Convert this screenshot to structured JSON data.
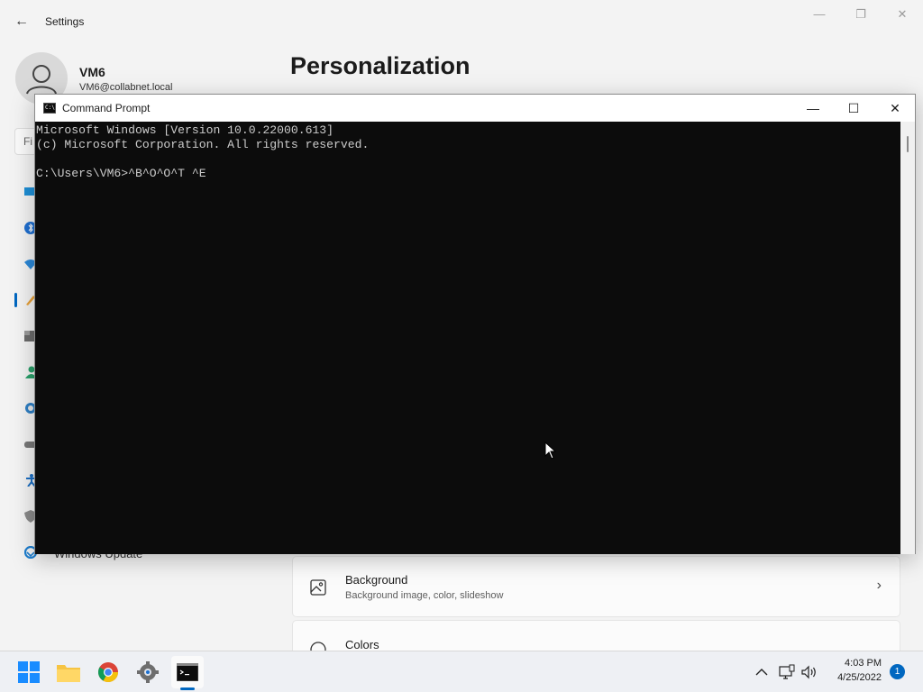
{
  "settings": {
    "app_title": "Settings",
    "back_glyph": "←",
    "controls": {
      "minimize": "—",
      "restore": "❐",
      "close": "✕"
    },
    "user": {
      "name": "VM6",
      "email": "VM6@collabnet.local"
    },
    "page_heading": "Personalization",
    "search_partial": "Fi",
    "nav_icons": [
      "display-icon",
      "bluetooth-icon",
      "network-icon",
      "personalization-brush-icon",
      "apps-icon",
      "accounts-icon",
      "time-language-icon",
      "gaming-icon",
      "accessibility-icon",
      "privacy-shield-icon",
      "windows-update-icon"
    ],
    "nav_visible_label": "Windows Update",
    "cards": [
      {
        "icon": "background-image-icon",
        "title": "Background",
        "subtitle": "Background image, color, slideshow"
      },
      {
        "icon": "colors-palette-icon",
        "title": "Colors",
        "subtitle": ""
      }
    ],
    "accent_color": "#0067c0"
  },
  "cmd": {
    "title": "Command Prompt",
    "icon_text": "C:\\",
    "controls": {
      "minimize": "—",
      "maximize": "☐",
      "close": "✕"
    },
    "lines": [
      "Microsoft Windows [Version 10.0.22000.613]",
      "(c) Microsoft Corporation. All rights reserved.",
      "",
      "C:\\Users\\VM6>^B^O^O^T ^E"
    ],
    "bg_color": "#0c0c0c",
    "text_color": "#cccccc"
  },
  "taskbar": {
    "apps": [
      {
        "name": "start-button",
        "icon": "windows-logo-icon"
      },
      {
        "name": "file-explorer",
        "icon": "folder-icon"
      },
      {
        "name": "chrome",
        "icon": "chrome-icon"
      },
      {
        "name": "settings",
        "icon": "gear-icon"
      },
      {
        "name": "command-prompt",
        "icon": "terminal-icon",
        "active": true
      }
    ],
    "tray": [
      "chevron-up-icon",
      "network-icon",
      "volume-icon"
    ],
    "time": "4:03 PM",
    "date": "4/25/2022",
    "notification_count": "1"
  }
}
